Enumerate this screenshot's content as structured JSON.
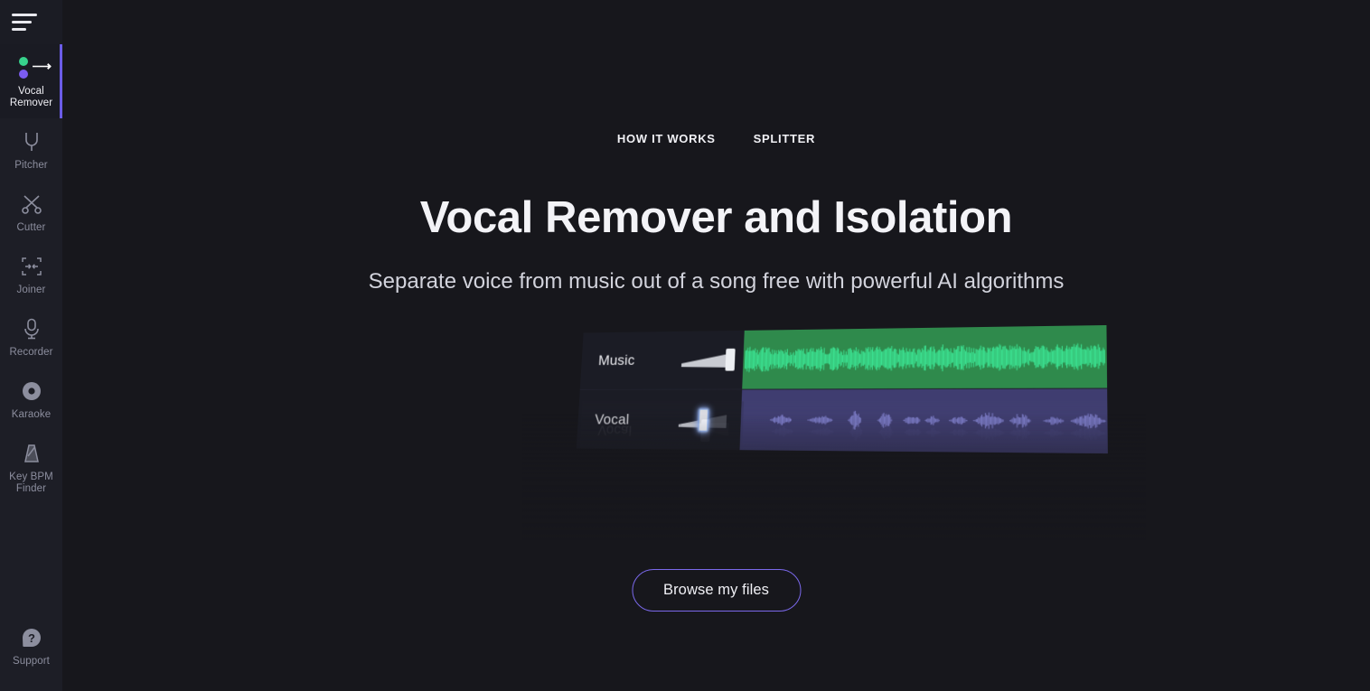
{
  "colors": {
    "page_bg": "#17171c",
    "sidebar_bg": "#1d1e26",
    "accent_purple": "#6b5ce7",
    "button_border": "#7a68ea",
    "music_track": "#2f8a4c",
    "music_wave": "#3ce896",
    "vocal_track": "#3f3d70",
    "vocal_wave": "#8b8bdd",
    "logo_green": "#37d28c",
    "logo_purple": "#7b5cf0"
  },
  "sidebar": {
    "menu_icon": "hamburger-icon",
    "items": [
      {
        "label": "Vocal\nRemover",
        "icon": "vocal-remover-logo-icon",
        "active": true
      },
      {
        "label": "Pitcher",
        "icon": "tuning-fork-icon",
        "active": false
      },
      {
        "label": "Cutter",
        "icon": "scissors-icon",
        "active": false
      },
      {
        "label": "Joiner",
        "icon": "join-arrows-icon",
        "active": false
      },
      {
        "label": "Recorder",
        "icon": "microphone-icon",
        "active": false
      },
      {
        "label": "Karaoke",
        "icon": "record-disc-icon",
        "active": false
      },
      {
        "label": "Key BPM\nFinder",
        "icon": "metronome-icon",
        "active": false
      }
    ],
    "support": {
      "label": "Support",
      "icon": "question-mark-icon"
    }
  },
  "topnav": {
    "links": [
      {
        "label": "HOW IT WORKS"
      },
      {
        "label": "SPLITTER"
      }
    ]
  },
  "hero": {
    "title": "Vocal Remover and Isolation",
    "subtitle": "Separate voice from music out of a song free with powerful AI algorithms",
    "browse_button": "Browse my files"
  },
  "illustration": {
    "tracks": [
      {
        "name": "Music",
        "slider_position": "max",
        "knob_highlighted": false
      },
      {
        "name": "Vocal",
        "slider_position": "mid",
        "knob_highlighted": true
      }
    ],
    "reflection_label": "Vocal"
  }
}
